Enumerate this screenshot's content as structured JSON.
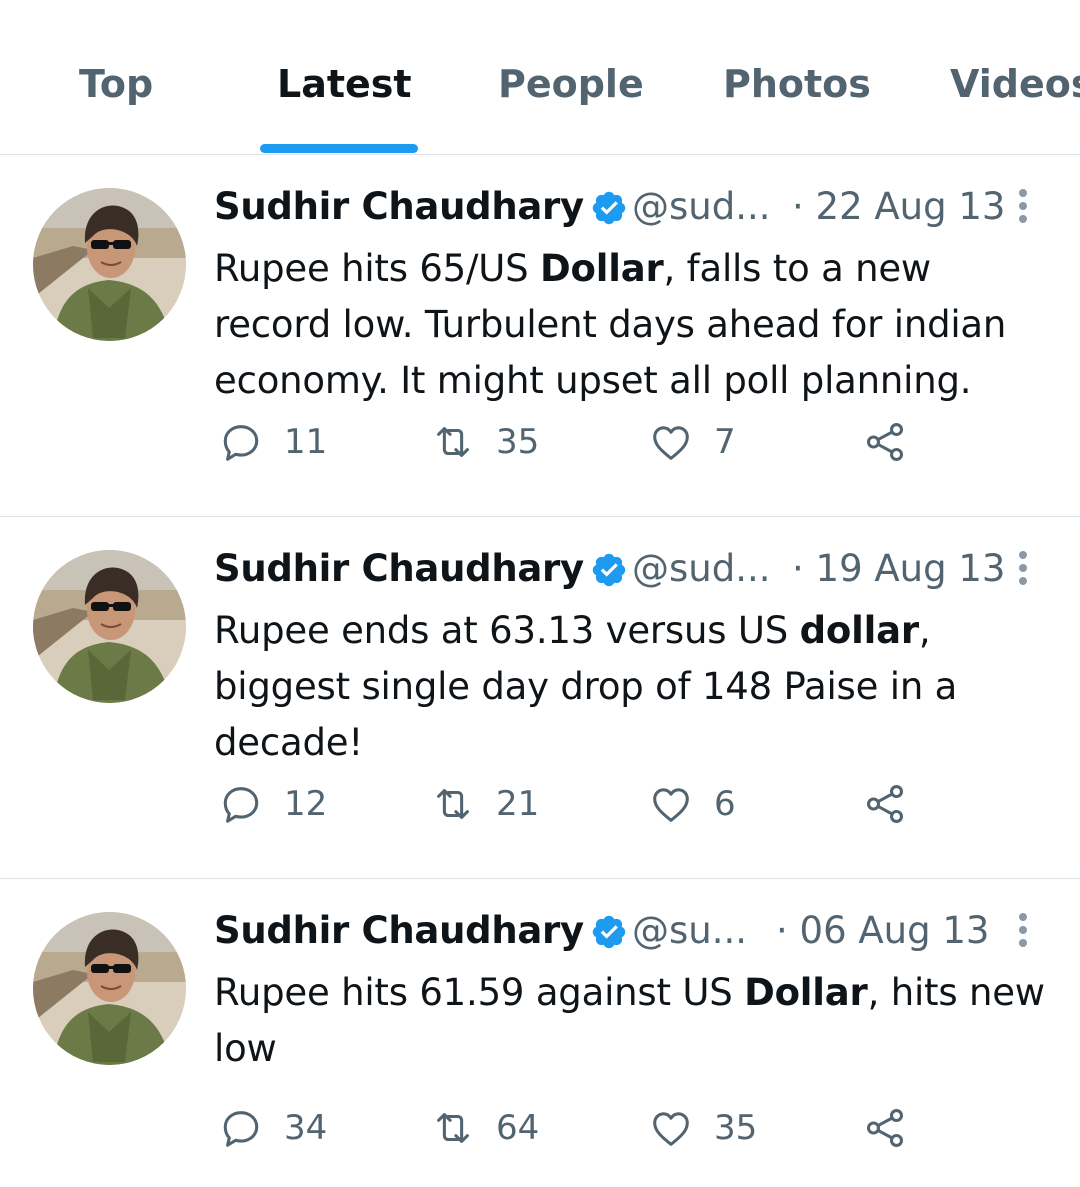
{
  "tabs": [
    {
      "label": "Top",
      "active": false
    },
    {
      "label": "Latest",
      "active": true
    },
    {
      "label": "People",
      "active": false
    },
    {
      "label": "Photos",
      "active": false
    },
    {
      "label": "Videos",
      "active": false
    }
  ],
  "colors": {
    "accent": "#1d9bf0",
    "secondary_text": "#536471",
    "primary_text": "#0f1419"
  },
  "tweets": [
    {
      "author": "Sudhir Chaudhary",
      "handle": "@sud...",
      "date": "· 22 Aug 13",
      "text": {
        "before": "Rupee hits 65/US ",
        "bold": "Dollar",
        "after": ", falls to a new record low. Turbulent days ahead for indian economy. It might upset all poll planning."
      },
      "replies": "11",
      "retweets": "35",
      "likes": "7"
    },
    {
      "author": "Sudhir Chaudhary",
      "handle": "@sud...",
      "date": "· 19 Aug 13",
      "text": {
        "before": "Rupee ends at 63.13 versus US ",
        "bold": "dollar",
        "after": ", biggest single day drop of 148 Paise in a decade!"
      },
      "replies": "12",
      "retweets": "21",
      "likes": "6"
    },
    {
      "author": "Sudhir Chaudhary",
      "handle": "@su...",
      "date": "· 06 Aug 13",
      "text": {
        "before": "Rupee hits 61.59 against US ",
        "bold": "Dollar",
        "after": ", hits new low"
      },
      "replies": "34",
      "retweets": "64",
      "likes": "35"
    }
  ]
}
